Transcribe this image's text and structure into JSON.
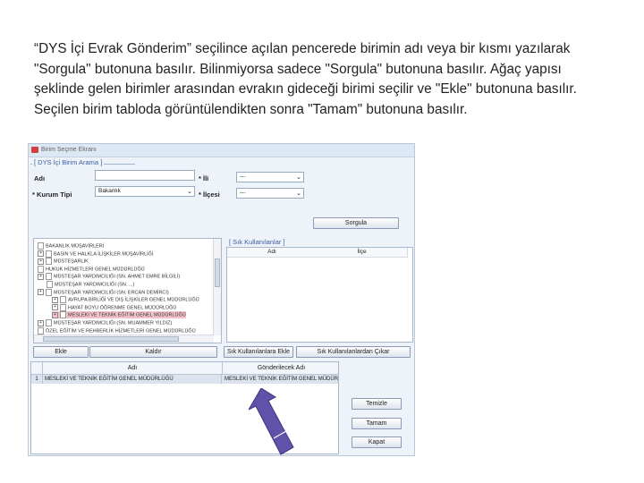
{
  "instruction": "“DYS İçi Evrak Gönderim” seçilince açılan pencerede birimin adı veya bir kısmı yazılarak \"Sorgula\" butonuna basılır. Bilinmiyorsa sadece \"Sorgula\" butonuna basılır. Ağaç yapısı şeklinde gelen birimler arasından evrakın gideceği birimi seçilir ve \"Ekle\" butonuna basılır. Seçilen birim tabloda görüntülendikten sonra \"Tamam\" butonuna basılır.",
  "window": {
    "title": "Birim Seçme Ekranı",
    "group_title": "[ DYS İçi Birim Arama ]",
    "form": {
      "adi_label": "Adı",
      "adi_value": "",
      "kurum_tipi_label": "* Kurum Tipi",
      "kurum_tipi_value": "Bakanlık",
      "il_label": "* İli",
      "il_value": "---",
      "ilce_label": "* İlçesi",
      "ilce_value": "---",
      "sorgula_label": "Sorgula"
    },
    "tree": [
      {
        "toggle": "",
        "text": "BAKANLIK MÜŞAVİRLERİ"
      },
      {
        "toggle": "+",
        "text": "BASIN VE HALKLA İLİŞKİLER MÜŞAVİRLİĞİ"
      },
      {
        "toggle": "+",
        "text": "MÜSTEŞARLIK"
      },
      {
        "toggle": "",
        "text": "HUKUK HİZMETLERİ GENEL MÜDÜRLÜĞÜ"
      },
      {
        "toggle": "+",
        "text": "MÜSTEŞAR YARDIMCILIĞI (SN. AHMET EMRE BİLGİLİ)"
      },
      {
        "toggle": "",
        "text": "MÜSTEŞAR YARDIMCILIĞI (SN. ...)"
      },
      {
        "toggle": "+",
        "text": "MÜSTEŞAR YARDIMCILIĞI (SN. ERCAN DEMİRCİ)"
      },
      {
        "toggle": "+",
        "text": "AVRUPA BİRLİĞİ VE DIŞ İLİŞKİLER GENEL MÜDÜRLÜĞÜ"
      },
      {
        "toggle": "+",
        "text": "HAYAT BOYU ÖĞRENME GENEL MÜDÜRLÜĞÜ"
      },
      {
        "toggle": "+",
        "text": "MESLEKİ VE TEKNİK EĞİTİM GENEL MÜDÜRLÜĞÜ"
      },
      {
        "toggle": "+",
        "text": "MÜSTEŞAR YARDIMCILIĞI (SN. MUAMMER YILDIZ)"
      },
      {
        "toggle": "",
        "text": "ÖZEL EĞİTİM VE REHBERLİK HİZMETLERİ GENEL MÜDÜRLÜĞÜ"
      }
    ],
    "selected_tree_index": 9,
    "frequent": {
      "title": "[ Sık Kullanılanlar ]",
      "col_adi": "Adı",
      "col_ilce": "İlçe"
    },
    "buttons": {
      "ekle": "Ekle",
      "kaldir": "Kaldır",
      "sik_ekle": "Sık Kullanılanlara Ekle",
      "sik_cikar": "Sık Kullanılanlardan Çıkar",
      "temizle": "Temizle",
      "tamam": "Tamam",
      "kapat": "Kapat"
    },
    "grid": {
      "col_adi": "Adı",
      "col_gonderilecek": "Gönderilecek Adı",
      "rows": [
        {
          "no": "1",
          "adi": "MESLEKİ VE TEKNİK EĞİTİM GENEL MÜDÜRLÜĞÜ",
          "gonderilecek": "MESLEKİ VE TEKNİK EĞİTİM GENEL MÜDÜRLÜĞÜ"
        }
      ]
    }
  },
  "colors": {
    "pointer_arrow": "#5f52a8",
    "selection_highlight": "#f3c3c9",
    "grid_selected_row": "#dbe3ee"
  }
}
